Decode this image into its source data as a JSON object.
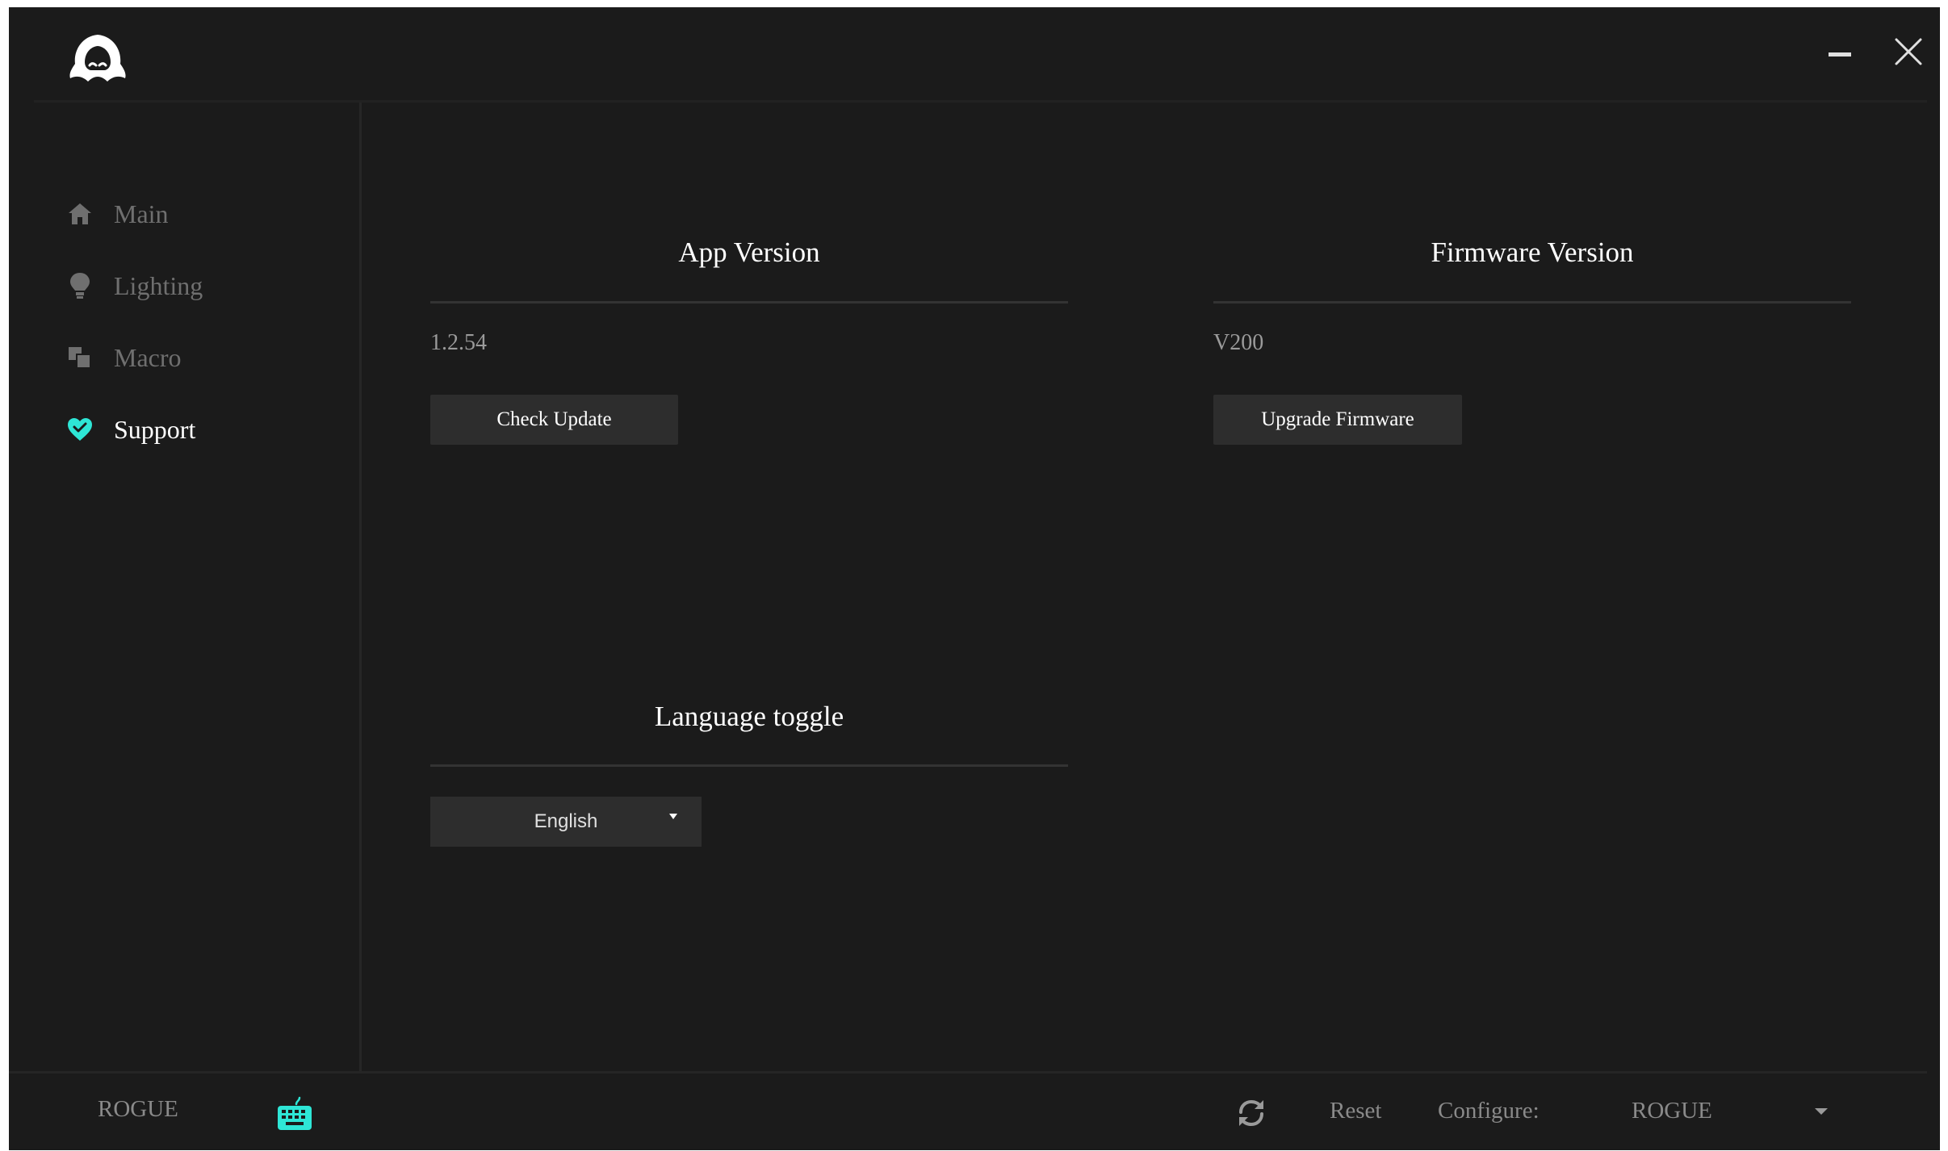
{
  "app": {
    "colors": {
      "background": "#1b1b1b",
      "accent": "#2ee6d6",
      "button": "#2d2d2d",
      "muted_text": "#6f6f6f"
    }
  },
  "titlebar": {
    "logo_icon": "hooded-figure-logo",
    "minimize_icon": "minimize-icon",
    "close_icon": "close-icon"
  },
  "sidebar": {
    "items": [
      {
        "label": "Main",
        "icon": "home-icon",
        "active": false
      },
      {
        "label": "Lighting",
        "icon": "lightbulb-icon",
        "active": false
      },
      {
        "label": "Macro",
        "icon": "macro-icon",
        "active": false
      },
      {
        "label": "Support",
        "icon": "heart-icon",
        "active": true
      }
    ]
  },
  "content": {
    "app_version": {
      "title": "App Version",
      "value": "1.2.54",
      "button_label": "Check Update"
    },
    "firmware_version": {
      "title": "Firmware Version",
      "value": "V200",
      "button_label": "Upgrade Firmware"
    },
    "language": {
      "title": "Language toggle",
      "selected": "English"
    }
  },
  "footer": {
    "device_name": "ROGUE",
    "device_icon": "keyboard-icon",
    "reset_icon": "refresh-icon",
    "reset_label": "Reset",
    "configure_label": "Configure:",
    "configure_value": "ROGUE"
  }
}
